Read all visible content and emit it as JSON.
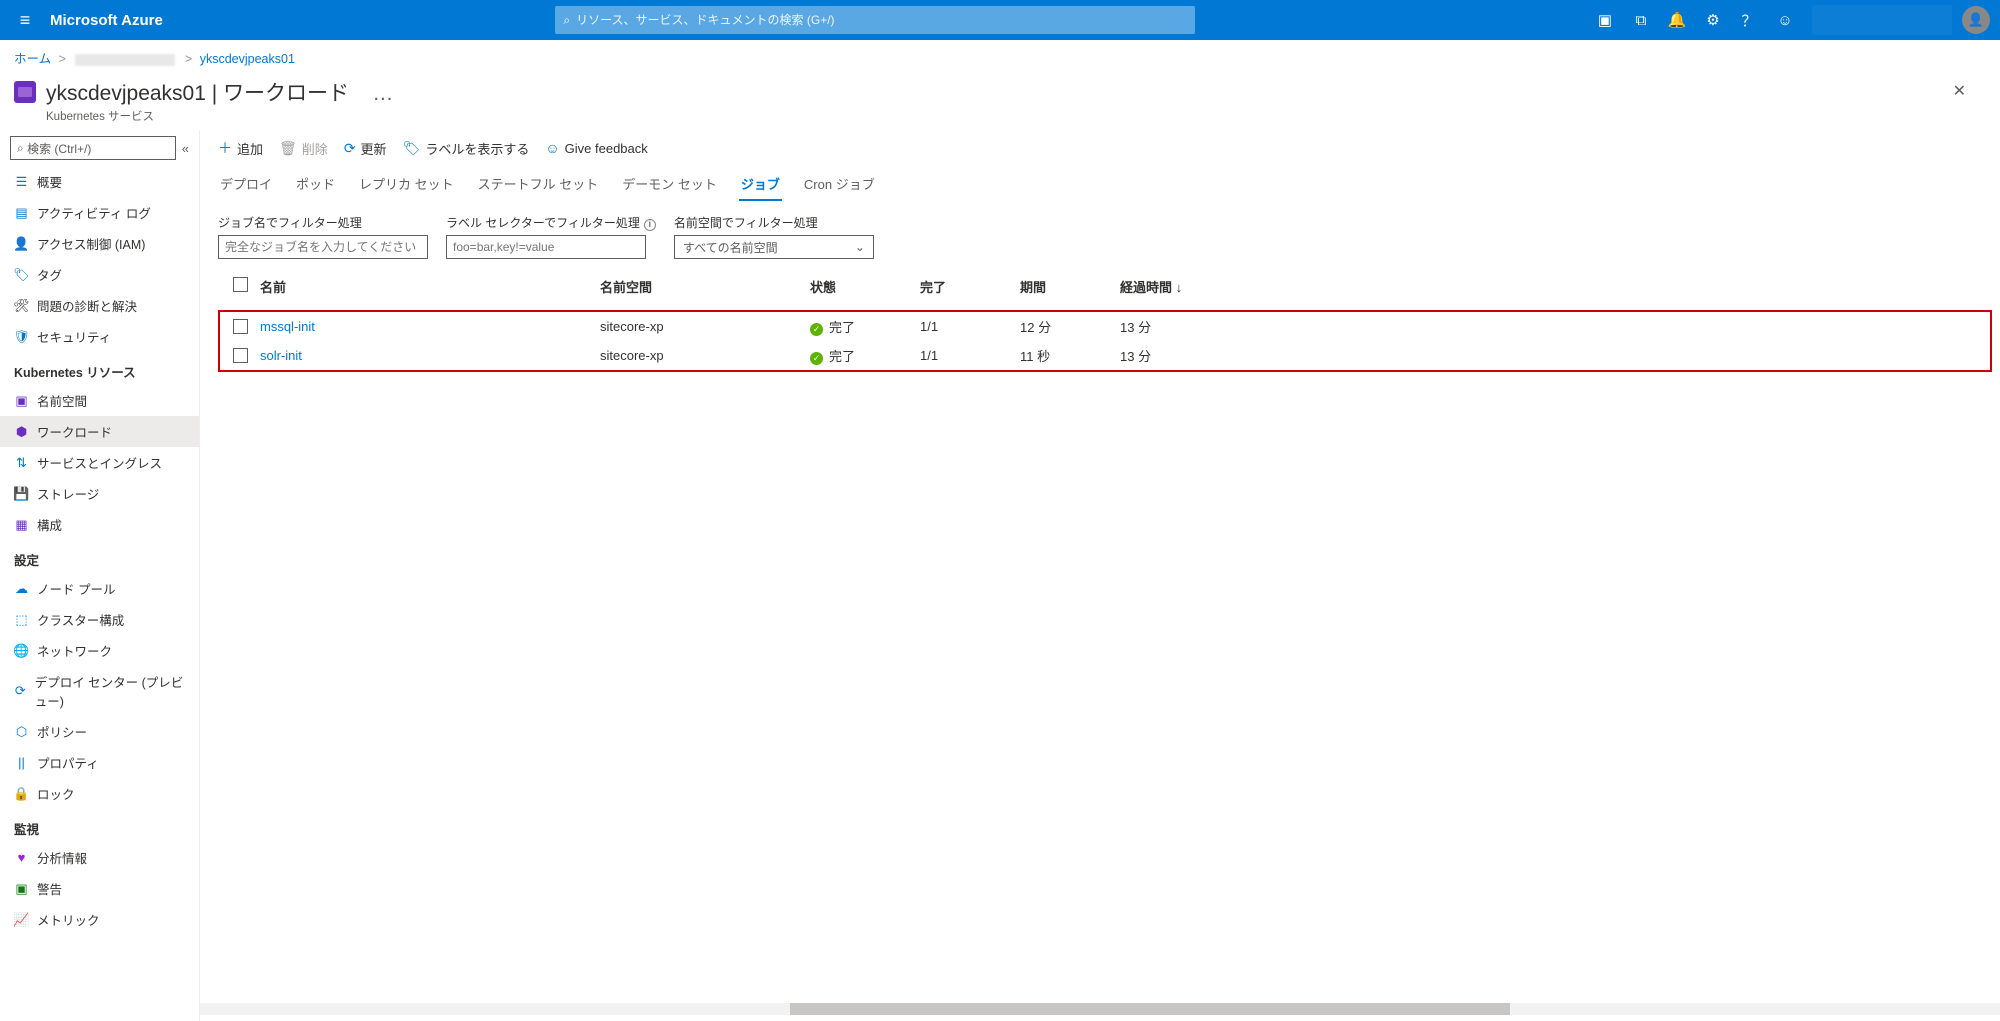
{
  "brand": "Microsoft Azure",
  "search": {
    "placeholder": "リソース、サービス、ドキュメントの検索 (G+/)"
  },
  "breadcrumb": {
    "home": "ホーム",
    "resource": "ykscdevjpeaks01"
  },
  "header": {
    "title": "ykscdevjpeaks01",
    "section": "ワークロード",
    "subtitle": "Kubernetes サービス",
    "more": "…"
  },
  "sidebar": {
    "search_placeholder": "検索 (Ctrl+/)",
    "groups": [
      {
        "items": [
          {
            "label": "概要",
            "icon": "#0078d4",
            "fill": "#8a61c9",
            "selected": false,
            "glyph": "☰"
          },
          {
            "label": "アクティビティ ログ",
            "icon": "#0078d4",
            "glyph": "▤"
          },
          {
            "label": "アクセス制御 (IAM)",
            "icon": "#0078d4",
            "glyph": "👤"
          },
          {
            "label": "タグ",
            "icon": "#0078d4",
            "glyph": "🏷"
          },
          {
            "label": "問題の診断と解決",
            "icon": "#323130",
            "glyph": "🛠"
          },
          {
            "label": "セキュリティ",
            "icon": "#0078d4",
            "glyph": "🛡"
          }
        ]
      },
      {
        "title": "Kubernetes リソース",
        "items": [
          {
            "label": "名前空間",
            "icon": "#6b2fbf",
            "glyph": "▣"
          },
          {
            "label": "ワークロード",
            "icon": "#6b2fbf",
            "selected": true,
            "glyph": "⬢"
          },
          {
            "label": "サービスとイングレス",
            "icon": "#0078d4",
            "glyph": "⇅"
          },
          {
            "label": "ストレージ",
            "icon": "#6b2fbf",
            "glyph": "💾"
          },
          {
            "label": "構成",
            "icon": "#6b2fbf",
            "glyph": "▦"
          }
        ]
      },
      {
        "title": "設定",
        "items": [
          {
            "label": "ノード プール",
            "icon": "#0078d4",
            "glyph": "☁"
          },
          {
            "label": "クラスター構成",
            "icon": "#0078d4",
            "glyph": "⬚"
          },
          {
            "label": "ネットワーク",
            "icon": "#0078d4",
            "glyph": "🌐"
          },
          {
            "label": "デプロイ センター (プレビュー)",
            "icon": "#0078d4",
            "glyph": "⟳"
          },
          {
            "label": "ポリシー",
            "icon": "#0078d4",
            "glyph": "⬡"
          },
          {
            "label": "プロパティ",
            "icon": "#0078d4",
            "glyph": "||"
          },
          {
            "label": "ロック",
            "icon": "#323130",
            "glyph": "🔒"
          }
        ]
      },
      {
        "title": "監視",
        "items": [
          {
            "label": "分析情報",
            "icon": "#9a1fd6",
            "glyph": "♥"
          },
          {
            "label": "警告",
            "icon": "#107c10",
            "glyph": "▣"
          },
          {
            "label": "メトリック",
            "icon": "#0078d4",
            "glyph": "📈"
          }
        ]
      }
    ]
  },
  "commands": {
    "add": "追加",
    "delete": "削除",
    "refresh": "更新",
    "show_labels": "ラベルを表示する",
    "give_feedback": "Give feedback"
  },
  "tabs": {
    "items": [
      "デプロイ",
      "ポッド",
      "レプリカ セット",
      "ステートフル セット",
      "デーモン セット",
      "ジョブ",
      "Cron ジョブ"
    ],
    "active_index": 5
  },
  "filters": {
    "job_name": {
      "label": "ジョブ名でフィルター処理",
      "placeholder": "完全なジョブ名を入力してください"
    },
    "label_selector": {
      "label": "ラベル セレクターでフィルター処理",
      "placeholder": "foo=bar,key!=value"
    },
    "namespace": {
      "label": "名前空間でフィルター処理",
      "value": "すべての名前空間"
    }
  },
  "table": {
    "headers": {
      "name": "名前",
      "namespace": "名前空間",
      "status": "状態",
      "complete": "完了",
      "duration": "期間",
      "elapsed": "経過時間 ↓"
    },
    "status_complete": "完了",
    "rows": [
      {
        "name": "mssql-init",
        "namespace": "sitecore-xp",
        "status": "完了",
        "complete": "1/1",
        "duration": "12 分",
        "elapsed": "13 分"
      },
      {
        "name": "solr-init",
        "namespace": "sitecore-xp",
        "status": "完了",
        "complete": "1/1",
        "duration": "11 秒",
        "elapsed": "13 分"
      }
    ]
  }
}
